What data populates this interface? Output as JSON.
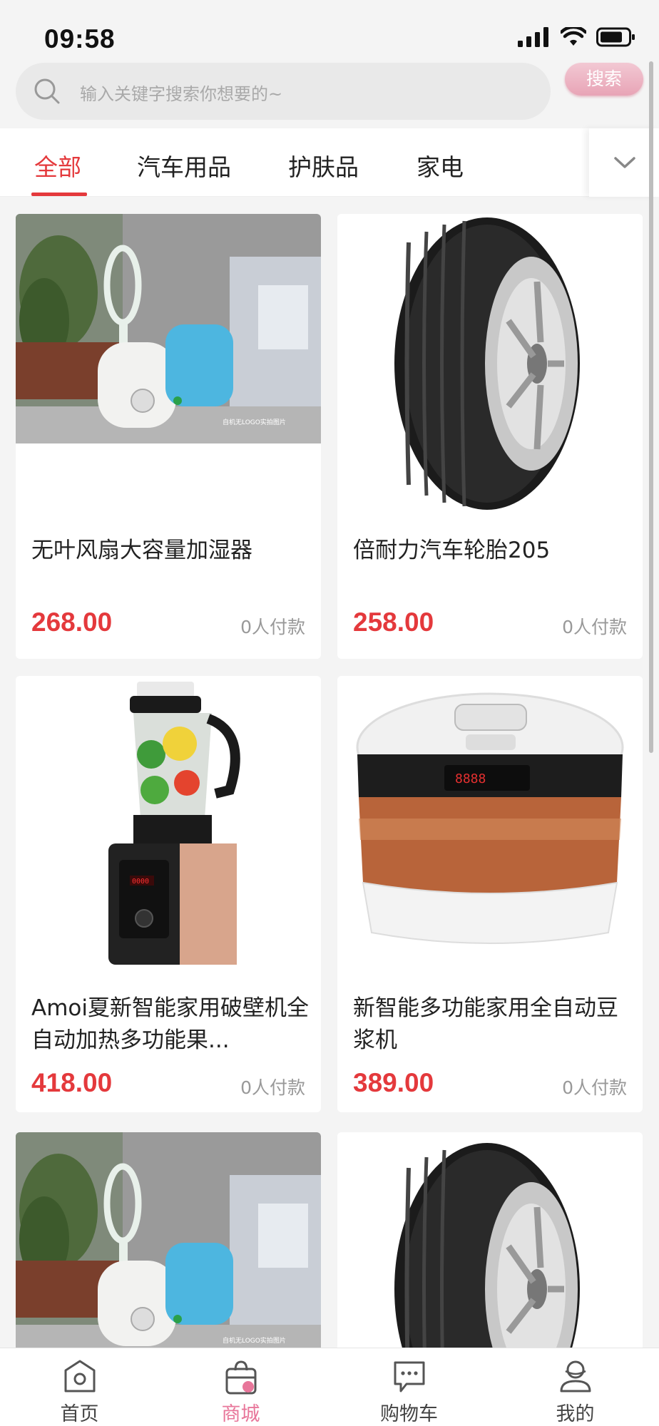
{
  "status": {
    "time": "09:58"
  },
  "search": {
    "placeholder": "输入关键字搜索你想要的~",
    "button_label": "搜索"
  },
  "tabs": [
    {
      "label": "全部",
      "active": true
    },
    {
      "label": "汽车用品",
      "active": false
    },
    {
      "label": "护肤品",
      "active": false
    },
    {
      "label": "家电",
      "active": false
    }
  ],
  "products": [
    {
      "title": "无叶风扇大容量加湿器",
      "price": "268.00",
      "sold": "0人付款",
      "image": "humidifier",
      "watermark": "自机无LOGO实拍图片"
    },
    {
      "title": "倍耐力汽车轮胎205",
      "price": "258.00",
      "sold": "0人付款",
      "image": "tire"
    },
    {
      "title": "Amoi夏新智能家用破壁机全自动加热多功能果...",
      "price": "418.00",
      "sold": "0人付款",
      "image": "blender"
    },
    {
      "title": "新智能多功能家用全自动豆浆机",
      "price": "389.00",
      "sold": "0人付款",
      "image": "rice-cooker"
    },
    {
      "title": "",
      "price": "",
      "sold": "",
      "image": "humidifier",
      "watermark": "自机无LOGO实拍图片"
    },
    {
      "title": "",
      "price": "",
      "sold": "",
      "image": "tire"
    }
  ],
  "tab_bar": [
    {
      "label": "首页",
      "icon": "home-icon",
      "active": false
    },
    {
      "label": "商城",
      "icon": "shopping-bag-icon",
      "active": true
    },
    {
      "label": "购物车",
      "icon": "chat-bubble-icon",
      "active": false
    },
    {
      "label": "我的",
      "icon": "profile-icon",
      "active": false
    }
  ],
  "colors": {
    "accent": "#e4393c",
    "tab_active": "#e8769a",
    "search_button": "#e8a4b6"
  }
}
